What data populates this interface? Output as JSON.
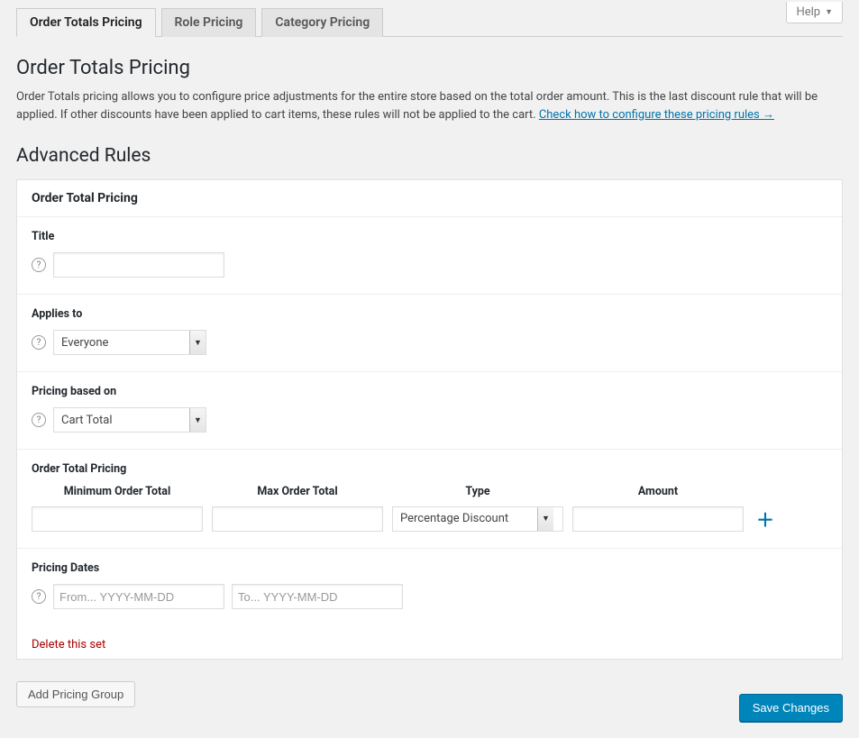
{
  "help_button": "Help",
  "tabs": {
    "order_totals": "Order Totals Pricing",
    "role": "Role Pricing",
    "category": "Category Pricing"
  },
  "page_title": "Order Totals Pricing",
  "description_pre": "Order Totals pricing allows you to configure price adjustments for the entire store based on the total order amount. This is the last discount rule that will be applied. If other discounts have been applied to cart items, these rules will not be applied to the cart. ",
  "description_link": "Check how to configure these pricing rules →",
  "advanced_title": "Advanced Rules",
  "card_header": "Order Total Pricing",
  "fields": {
    "title_label": "Title",
    "title_value": "",
    "applies_label": "Applies to",
    "applies_value": "Everyone",
    "basis_label": "Pricing based on",
    "basis_value": "Cart Total",
    "otp_label": "Order Total Pricing",
    "col_min": "Minimum Order Total",
    "col_max": "Max Order Total",
    "col_type": "Type",
    "col_amt": "Amount",
    "min_value": "",
    "max_value": "",
    "type_value": "Percentage Discount",
    "amt_value": "",
    "dates_label": "Pricing Dates",
    "from_placeholder": "From... YYYY-MM-DD",
    "to_placeholder": "To... YYYY-MM-DD",
    "from_value": "",
    "to_value": ""
  },
  "delete_link": "Delete this set",
  "add_group": "Add Pricing Group",
  "save": "Save Changes"
}
